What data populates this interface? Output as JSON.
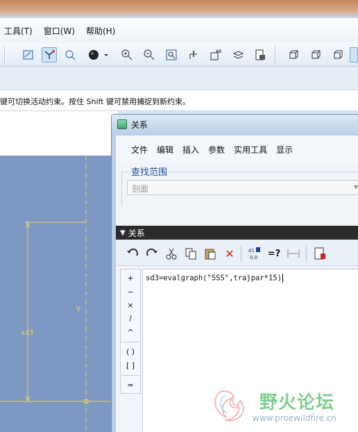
{
  "menubar": {
    "items": [
      "工具(T)",
      "窗口(W)",
      "帮助(H)"
    ]
  },
  "message": {
    "text": "键可切换活动约束。按住 Shift 键可禁用捕捉到新约束。"
  },
  "graphics": {
    "dim_sd3": "sd3",
    "dim_v": "V"
  },
  "dialog": {
    "title": "关系",
    "menu": [
      "文件",
      "编辑",
      "插入",
      "参数",
      "实用工具",
      "显示"
    ],
    "scope_label": "查找范围",
    "scope_value": "剖面",
    "section_label": "关系",
    "operators": [
      "+",
      "−",
      "×",
      "/",
      "^",
      "( )",
      "[ ]",
      "="
    ],
    "relation_text": "sd3=evalgraph(\"SSS\",trajpar*15)"
  },
  "watermark": {
    "title": "野火论坛",
    "url": "www.proewildfire.cn"
  },
  "colors": {
    "graphics_bg": "#7e98c4",
    "dimension": "#f0d25a",
    "section_header": "#2b2b2b"
  }
}
